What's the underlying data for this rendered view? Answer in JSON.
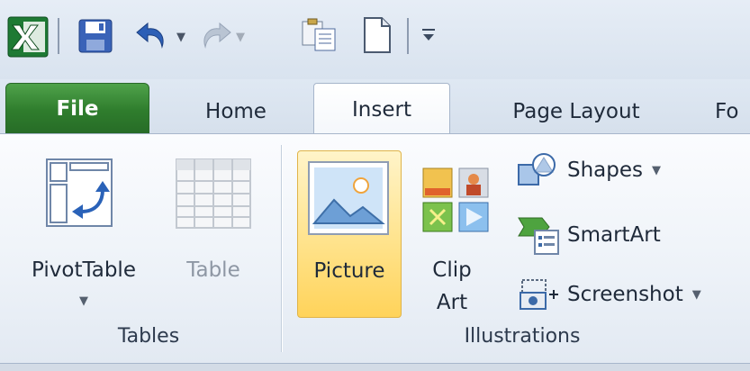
{
  "quick_access": {
    "icons": [
      "excel-logo-icon",
      "save-icon",
      "undo-icon",
      "redo-icon",
      "paste-icon",
      "new-document-icon",
      "customize-toolbar-icon"
    ]
  },
  "tabs": {
    "file": "File",
    "home": "Home",
    "insert": "Insert",
    "page_layout": "Page Layout",
    "formulas_partial": "Fo"
  },
  "groups": {
    "tables": {
      "label": "Tables",
      "pivottable": "PivotTable",
      "table": "Table"
    },
    "illustrations": {
      "label": "Illustrations",
      "picture": "Picture",
      "clip_art_line1": "Clip",
      "clip_art_line2": "Art",
      "shapes": "Shapes",
      "smartart": "SmartArt",
      "screenshot": "Screenshot"
    }
  },
  "colors": {
    "file_tab": "#2f7d2d",
    "picture_highlight": "#ffe38c",
    "ribbon_bg": "#edf2f8"
  }
}
